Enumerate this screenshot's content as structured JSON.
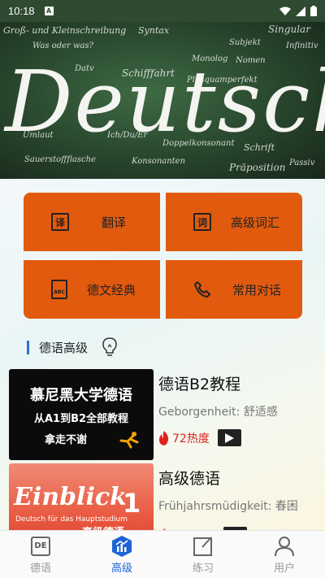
{
  "status_bar": {
    "time": "10:18",
    "sim_label": "A"
  },
  "banner": {
    "word": "Deutsch",
    "chalk_words": [
      "Syntax",
      "Groß- und Kleinschreibung",
      "Was oder was?",
      "Datv",
      "Schifffahrt",
      "Plusquamperfekt",
      "Monolog",
      "Umlaut",
      "Ich/Du/Er",
      "Doppelkonsonant",
      "Schrift",
      "Sauerstoffflasche",
      "Konsonanten",
      "Präposition",
      "Passiv",
      "Subjekt",
      "Infinitiv",
      "Singular",
      "Nomen"
    ]
  },
  "menu": {
    "translate": {
      "label": "翻译",
      "icon_char": "译"
    },
    "vocab": {
      "label": "高级词汇",
      "icon_char": "词"
    },
    "classics": {
      "label": "德文经典",
      "icon_char": "ABC"
    },
    "dialog": {
      "label": "常用对话"
    }
  },
  "section": {
    "title": "德语高级"
  },
  "courses": [
    {
      "title": "德语B2教程",
      "subtitle": "Geborgenheit: 舒适感",
      "heat": "72热度",
      "thumb_line1": "慕尼黑大学德语",
      "thumb_line2": "从A1到B2全部教程",
      "thumb_line3": "拿走不谢"
    },
    {
      "title": "高级德语",
      "subtitle": "Frühjahrsmüdigkeit: 春困",
      "thumb_title": "Einblick",
      "thumb_number": "1",
      "thumb_caption": "Deutsch für das Hauptstudium",
      "thumb_cn": "高级德语"
    }
  ],
  "tabs": [
    {
      "label": "德语",
      "icon_text": "DE"
    },
    {
      "label": "高级"
    },
    {
      "label": "练习"
    },
    {
      "label": "用户"
    }
  ],
  "colors": {
    "tile": "#e25a0e",
    "accent": "#1e63d6",
    "heat": "#e0231f"
  }
}
